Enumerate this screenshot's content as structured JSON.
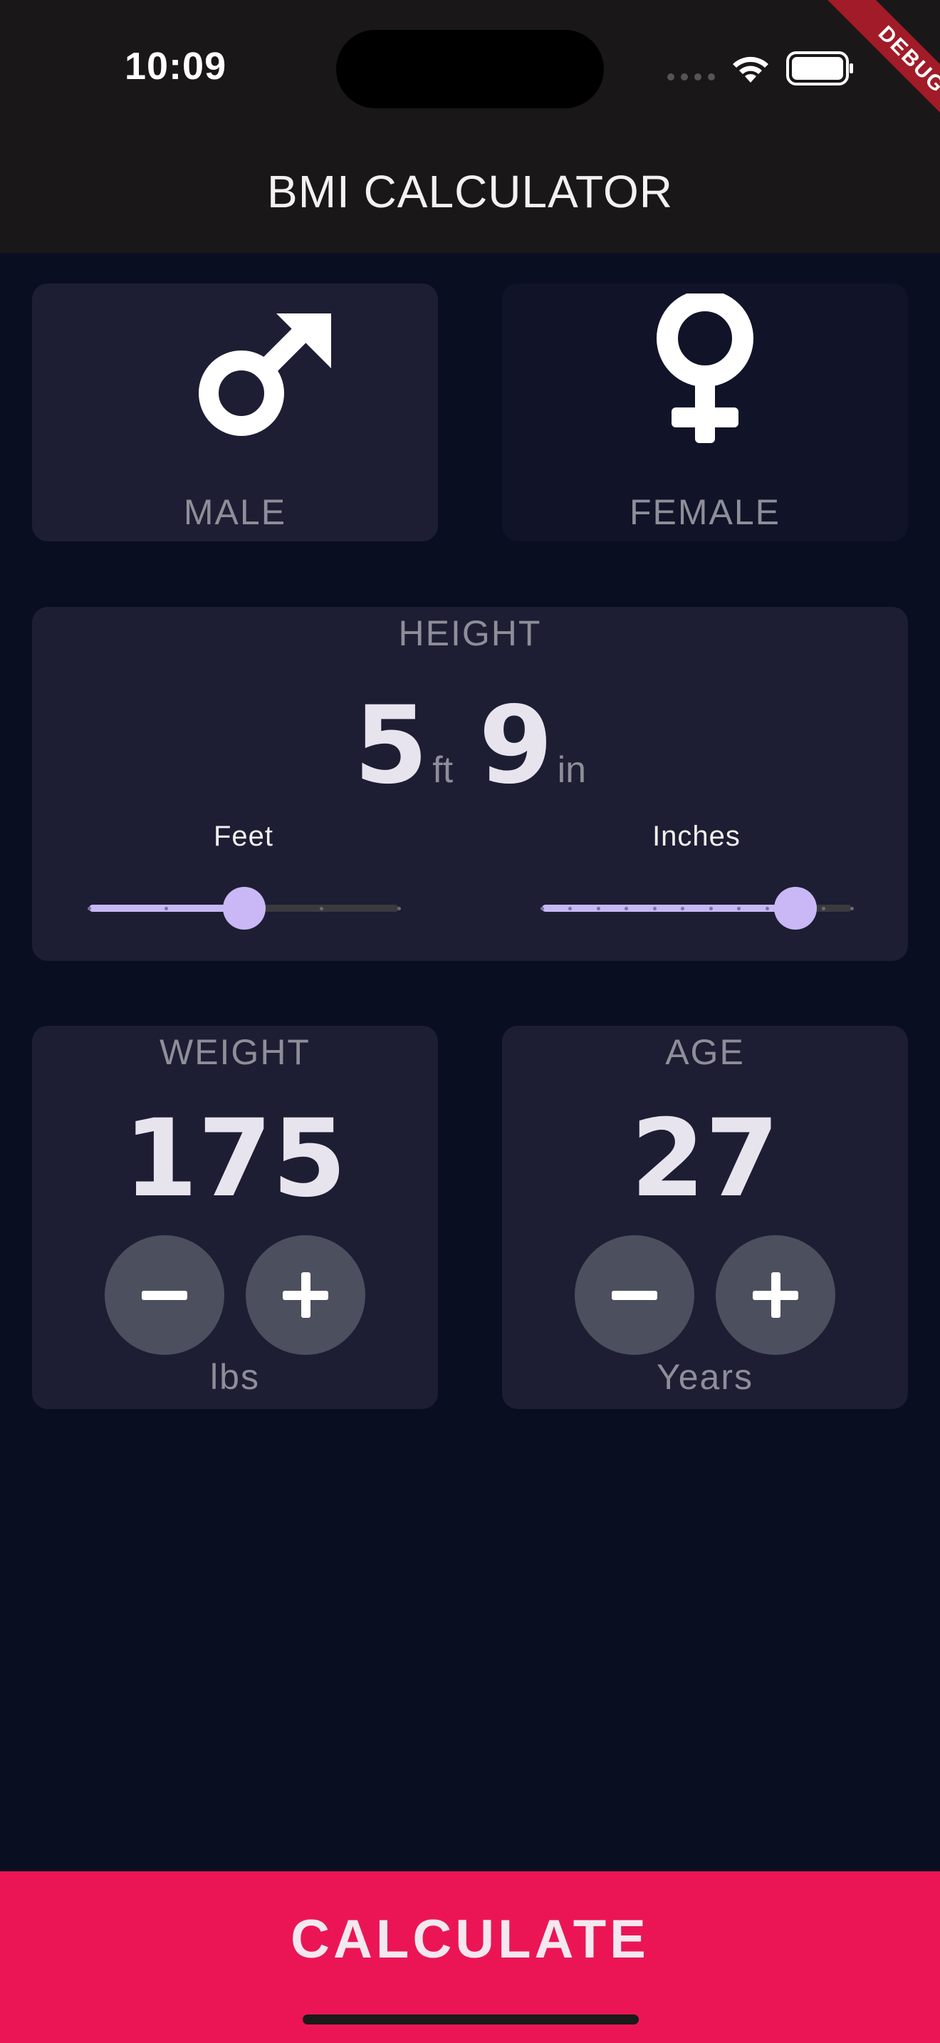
{
  "status_bar": {
    "time": "10:09"
  },
  "debug_banner": "DEBUG",
  "app_bar": {
    "title": "BMI CALCULATOR"
  },
  "gender": {
    "male_label": "MALE",
    "female_label": "FEMALE",
    "selected": "male"
  },
  "height": {
    "label": "HEIGHT",
    "feet_value": "5",
    "feet_unit": "ft",
    "inches_value": "9",
    "inches_unit": "in",
    "feet_slider": {
      "label": "Feet",
      "min": 3,
      "max": 7,
      "value": 5
    },
    "inches_slider": {
      "label": "Inches",
      "min": 0,
      "max": 11,
      "value": 9
    }
  },
  "weight": {
    "label": "WEIGHT",
    "value": "175",
    "unit": "lbs"
  },
  "age": {
    "label": "AGE",
    "value": "27",
    "unit": "Years"
  },
  "calculate_button": {
    "label": "CALCULATE"
  },
  "colors": {
    "background": "#0a0e21",
    "card_active": "#1d1e33",
    "card_inactive": "#111328",
    "accent": "#eb1555",
    "slider": "#c7b8f6"
  }
}
